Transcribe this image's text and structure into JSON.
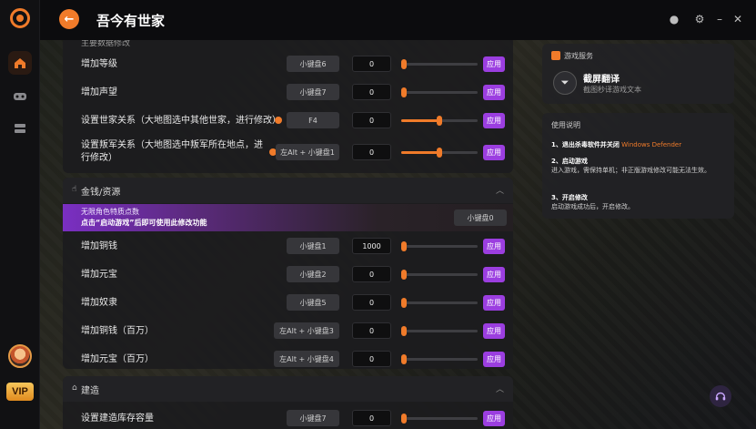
{
  "app": {
    "title": "吾今有世家"
  },
  "sidebar": {
    "vip_label": "VIP"
  },
  "panel1": {
    "cut_header": "主要数据修改",
    "rows": [
      {
        "label": "增加等级",
        "hotkey": "小键盘6",
        "value": "0",
        "slider": 0,
        "apply": "应用"
      },
      {
        "label": "增加声望",
        "hotkey": "小键盘7",
        "value": "0",
        "slider": 0,
        "apply": "应用"
      },
      {
        "label": "设置世家关系（大地图选中其他世家，进行修改）",
        "hotkey": "F4",
        "value": "0",
        "slider": 0.5,
        "apply": "应用"
      },
      {
        "label": "设置叛军关系（大地图选中叛军所在地点，进行修改）",
        "hotkey": "左Alt + 小键盘1",
        "value": "0",
        "slider": 0.5,
        "apply": "应用"
      }
    ]
  },
  "money": {
    "title": "金钱/资源",
    "banner_line1": "无限角色特质点数",
    "banner_line2": "点击“启动游戏”后即可使用此修改功能",
    "banner_hotkey": "小键盘0",
    "rows": [
      {
        "label": "增加铜钱",
        "hotkey": "小键盘1",
        "value": "1000",
        "apply": "应用"
      },
      {
        "label": "增加元宝",
        "hotkey": "小键盘2",
        "value": "0",
        "apply": "应用"
      },
      {
        "label": "增加奴隶",
        "hotkey": "小键盘5",
        "value": "0",
        "apply": "应用"
      },
      {
        "label": "增加铜钱（百万）",
        "hotkey": "左Alt + 小键盘3",
        "value": "0",
        "apply": "应用"
      },
      {
        "label": "增加元宝（百万）",
        "hotkey": "左Alt + 小键盘4",
        "value": "0",
        "apply": "应用"
      }
    ]
  },
  "build": {
    "title": "建造",
    "cut_row_label": "设置建造库存容量",
    "cut_row_hotkey": "小键盘7",
    "cut_row_value": "0",
    "cut_row_apply": "应用"
  },
  "services": {
    "title": "游戏服务",
    "tool_name": "截屏翻译",
    "tool_desc": "截图秒译游戏文本"
  },
  "instructions": {
    "title": "使用说明",
    "step1_title": "1、退出杀毒软件并关闭",
    "step1_hl": "Windows Defender",
    "step2_title": "2、启动游戏",
    "step2_text": "进入游戏，需保持单机；非正版游戏修改可能无法生效。",
    "step3_title": "3、开启修改",
    "step3_text": "启动游戏成功后，开启修改。"
  },
  "colors": {
    "accent": "#f07b2a",
    "apply": "#9b3ee0"
  }
}
